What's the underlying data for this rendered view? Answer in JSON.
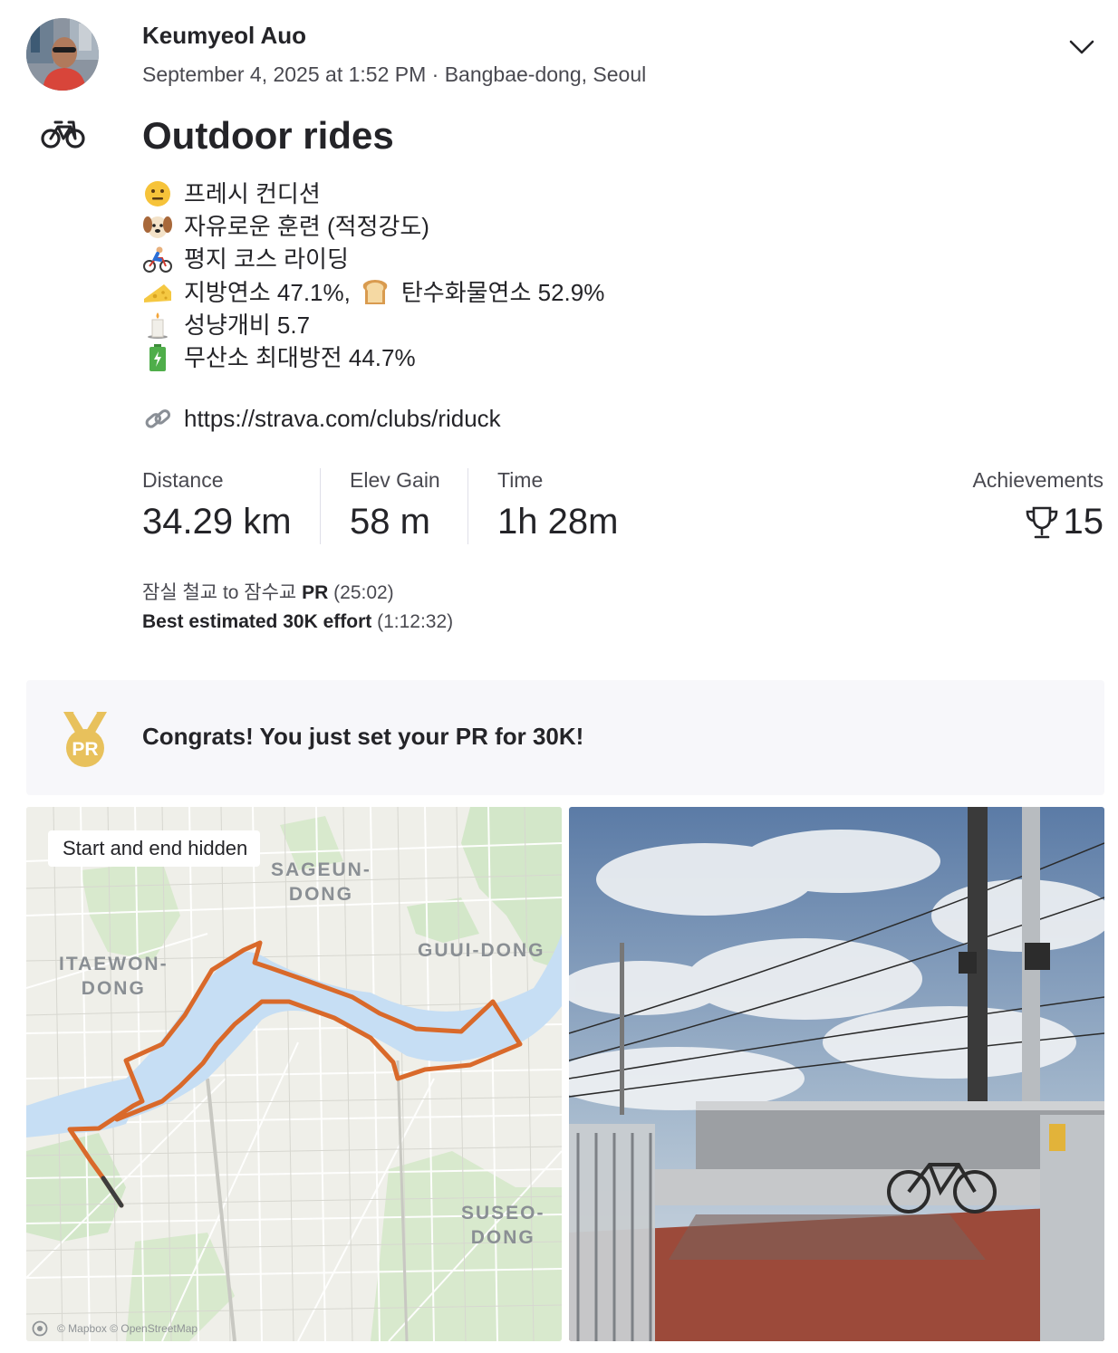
{
  "athlete": {
    "name": "Keumyeol Auo",
    "datetime": "September 4, 2025 at 1:52 PM",
    "separator": " · ",
    "location": "Bangbae-dong, Seoul"
  },
  "activity": {
    "sport_icon": "bicycle-icon",
    "title": "Outdoor rides",
    "description_lines": [
      {
        "icon": "neutral-face-emoji",
        "text": "프레시 컨디션"
      },
      {
        "icon": "dog-face-emoji",
        "text": "자유로운 훈련 (적정강도)"
      },
      {
        "icon": "cyclist-emoji",
        "text": "평지 코스 라이딩"
      },
      {
        "icon": "cheese-emoji",
        "text": "지방연소 47.1%,",
        "icon2": "bread-emoji",
        "text2": "탄수화물연소 52.9%"
      },
      {
        "icon": "candle-emoji",
        "text": "성냥개비 5.7"
      },
      {
        "icon": "battery-emoji",
        "text": "무산소 최대방전 44.7%"
      }
    ],
    "link": {
      "icon": "link-emoji",
      "text": "https://strava.com/clubs/riduck"
    }
  },
  "stats": {
    "distance": {
      "label": "Distance",
      "value": "34.29 km"
    },
    "elev_gain": {
      "label": "Elev Gain",
      "value": "58 m"
    },
    "time": {
      "label": "Time",
      "value": "1h 28m"
    },
    "achievements": {
      "label": "Achievements",
      "value": "15",
      "icon": "trophy-icon"
    }
  },
  "segments": [
    {
      "name": "잠실 철교 to 잠수교",
      "badge": "PR",
      "time": "(25:02)"
    },
    {
      "name": "Best estimated 30K effort",
      "time": "(1:12:32)"
    }
  ],
  "pr_banner": {
    "icon": "pr-medal-icon",
    "icon_text": "PR",
    "text": "Congrats! You just set your PR for 30K!",
    "accent": "#e8c15c"
  },
  "map": {
    "badge_prefix": "S",
    "badge": "Start and end hidden",
    "labels": {
      "sageun_1": "SAGEUN-",
      "sageun_2": "DONG",
      "guui": "GUUI-DONG",
      "itaewon_1": "ITAEWON-",
      "itaewon_2": "DONG",
      "suseo_1": "SUSEO-",
      "suseo_2": "DONG"
    },
    "attribution": "© Mapbox © OpenStreetMap",
    "route_color": "#d9692a",
    "water_color": "#c6def4"
  },
  "photo": {
    "alt": "ride-photo"
  }
}
